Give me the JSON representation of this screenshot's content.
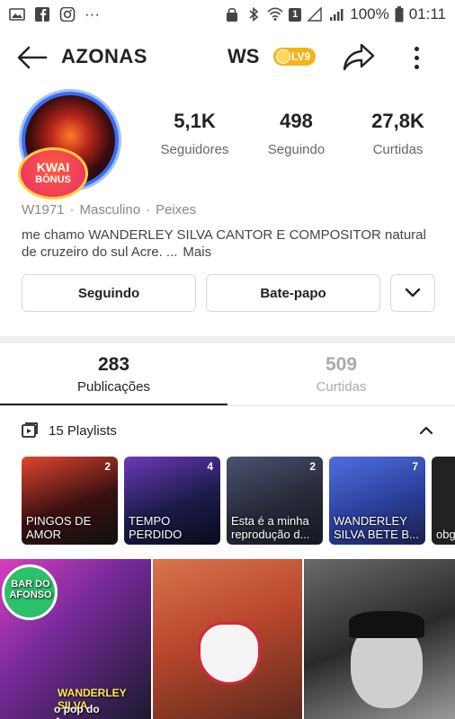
{
  "status_bar": {
    "battery": "100%",
    "time": "01:11",
    "notif_count": "1"
  },
  "header": {
    "username_left": "AZONAS",
    "username_right": "WS",
    "level": "LV9"
  },
  "profile": {
    "badge_line1": "KWAI",
    "badge_line2": "BÔNUS",
    "stats": [
      {
        "value": "5,1K",
        "label": "Seguidores"
      },
      {
        "value": "498",
        "label": "Seguindo"
      },
      {
        "value": "27,8K",
        "label": "Curtidas"
      }
    ],
    "meta": {
      "id": "W1971",
      "gender": "Masculino",
      "sign": "Peixes"
    },
    "bio": "me chamo WANDERLEY SILVA CANTOR E COMPOSITOR natural de cruzeiro do sul Acre. ...",
    "bio_more": "Mais"
  },
  "actions": {
    "follow_label": "Seguindo",
    "chat_label": "Bate-papo"
  },
  "tabs": [
    {
      "count": "283",
      "label": "Publicações",
      "active": true
    },
    {
      "count": "509",
      "label": "Curtidas",
      "active": false
    }
  ],
  "playlists": {
    "title": "15 Playlists",
    "items": [
      {
        "count": "2",
        "title": "PINGOS DE AMOR",
        "color": "#3a1010"
      },
      {
        "count": "4",
        "title": "TEMPO PERDIDO",
        "color": "#1b1b4a"
      },
      {
        "count": "2",
        "title": "Esta é a minha reprodução d...",
        "color": "#262a38"
      },
      {
        "count": "7",
        "title": "WANDERLEY SILVA BETE B...",
        "color": "#2a3f9a"
      },
      {
        "count": "",
        "title": "obg tud",
        "color": "#222222"
      }
    ]
  },
  "videos": [
    {
      "top_text": "BAR DO AFONSO",
      "bottom_text": "WANDERLEY SILVA",
      "sub_text": "o pop do Amazonas"
    },
    {
      "top_text": "",
      "bottom_text": "",
      "sub_text": ""
    },
    {
      "top_text": "",
      "bottom_text": "",
      "sub_text": ""
    }
  ]
}
